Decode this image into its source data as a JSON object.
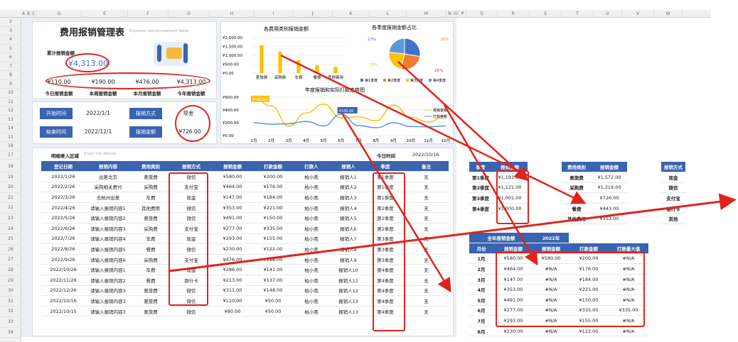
{
  "columns": [
    "A",
    "B",
    "C",
    "D",
    "E",
    "F",
    "G",
    "H",
    "I",
    "J",
    "K",
    "L",
    "M",
    "N",
    "O",
    "P",
    "Q",
    "R",
    "S",
    "T",
    "U",
    "V",
    "W"
  ],
  "rows": [
    "2",
    "3",
    "4",
    "5",
    "6",
    "7",
    "8",
    "9",
    "10",
    "11",
    "12",
    "13",
    "14",
    "15",
    "16",
    "17",
    "18",
    "19",
    "20",
    "21",
    "22",
    "23",
    "24",
    "25",
    "26",
    "27",
    "28",
    "29",
    "30",
    "31",
    "32",
    "33",
    "34"
  ],
  "dashboard": {
    "title": "费用报销管理表",
    "subtitle": "Expense reimbursement table",
    "total_label": "累计报销金额",
    "total_value": "¥4,313.00",
    "kpis": [
      {
        "value": "¥110.00",
        "label": "今日报销金额"
      },
      {
        "value": "¥190.00",
        "label": "本周报销金额"
      },
      {
        "value": "¥476.00",
        "label": "本月报销金额"
      },
      {
        "value": "¥4,313.00",
        "label": "今年报销金额"
      }
    ],
    "filters": {
      "start_label": "开始时间",
      "start_value": "2022/1/1",
      "method_label": "报销方式",
      "method_value": "现金",
      "end_label": "结束时间",
      "end_value": "2022/12/1",
      "amount_label": "报销金额",
      "amount_value": "¥726.00"
    }
  },
  "bar_chart": {
    "title": "各费用类别报销金额",
    "ticks": [
      "¥2,000.00",
      "¥1,500.00",
      "¥1,000.00",
      "¥500.00",
      "¥0.00"
    ]
  },
  "pie_chart": {
    "title": "各季度报销金额占比",
    "labels": [
      "23%",
      "28%",
      "26%",
      "23%"
    ],
    "legend": [
      "第1季度",
      "第2季度",
      "第3季度",
      "第4季度"
    ]
  },
  "line_chart": {
    "title": "年度报销和实际打款走势图",
    "ticks": [
      "¥600.00",
      "¥400.00",
      "¥200.00",
      "¥0.00"
    ],
    "callout1": "¥580.00",
    "callout2": "¥335.00",
    "legend": [
      "报销金额",
      "打款金额"
    ]
  },
  "chart_data": [
    {
      "type": "bar",
      "categories": [
        "差旅费",
        "采购费",
        "车费",
        "餐费",
        "其他费用"
      ],
      "values": [
        1572,
        1219,
        726,
        443,
        353
      ],
      "ylim": [
        0,
        2000
      ]
    },
    {
      "type": "pie",
      "categories": [
        "第1季度",
        "第2季度",
        "第3季度",
        "第4季度"
      ],
      "values": [
        1191,
        1121,
        1001,
        1000
      ],
      "colors": [
        "#4472c4",
        "#ed7d31",
        "#ffc000",
        "#5b9bd5"
      ]
    },
    {
      "type": "line",
      "categories": [
        "1月",
        "2月",
        "3月",
        "4月",
        "5月",
        "6月",
        "7月",
        "8月",
        "9月",
        "10月",
        "11月",
        "12月"
      ],
      "series": [
        {
          "name": "报销金额",
          "values": [
            580,
            464,
            147,
            353,
            491,
            277,
            293,
            230,
            476,
            286,
            213,
            311
          ],
          "color": "#ffc000"
        },
        {
          "name": "打款金额",
          "values": [
            200,
            176,
            184,
            221,
            150,
            335,
            155,
            122,
            198,
            141,
            137,
            148
          ],
          "color": "#5b9bd5"
        }
      ],
      "ylim": [
        0,
        600
      ]
    }
  ],
  "detail": {
    "section_label": "明细录入区域",
    "section_hint": "Enter the details",
    "today_label": "今日时间",
    "today_value": "2022/10/16",
    "headers": [
      "登记日期",
      "报销内容",
      "费用类别",
      "报销方式",
      "报销金额",
      "打款金额",
      "打款人",
      "报销人",
      "季度",
      "备注"
    ],
    "rows": [
      [
        "2022/1/26",
        "出差北京",
        "差旅费",
        "微信",
        "¥580.00",
        "¥200.00",
        "柏小莞",
        "报销人1",
        "第1季度",
        "无"
      ],
      [
        "2022/2/26",
        "采购相关费付",
        "采购费",
        "支付宝",
        "¥464.00",
        "¥176.00",
        "柏小莞",
        "报销人2",
        "第1季度",
        "无"
      ],
      [
        "2022/3/26",
        "去杭州出差",
        "车费",
        "现金",
        "¥147.00",
        "¥184.00",
        "柏小莞",
        "报销人3",
        "第1季度",
        "无"
      ],
      [
        "2022/4/26",
        "请输入报销内容1",
        "其他费用",
        "微信",
        "¥353.00",
        "¥221.00",
        "柏小莞",
        "报销人4",
        "第2季度",
        "无"
      ],
      [
        "2022/5/26",
        "请输入报销内容2",
        "差旅费",
        "微信",
        "¥491.00",
        "¥150.00",
        "柏小莞",
        "报销人5",
        "第2季度",
        "无"
      ],
      [
        "2022/6/26",
        "请输入报销内容3",
        "采购费",
        "支付宝",
        "¥277.00",
        "¥335.00",
        "柏小莞",
        "报销人6",
        "第2季度",
        "无"
      ],
      [
        "2022/7/26",
        "请输入报销内容4",
        "车费",
        "现金",
        "¥293.00",
        "¥155.00",
        "柏小莞",
        "报销人7",
        "第3季度",
        "无"
      ],
      [
        "2022/8/26",
        "请输入报销内容5",
        "餐费",
        "微信",
        "¥230.00",
        "¥122.00",
        "柏小莞",
        "报销人8",
        "第3季度",
        "无"
      ],
      [
        "2022/9/26",
        "请输入报销内容6",
        "采购费",
        "支付宝",
        "¥476.00",
        "¥198.00",
        "柏小莞",
        "报销人9",
        "第3季度",
        "无"
      ],
      [
        "2022/10/26",
        "请输入报销内容1",
        "车费",
        "现金",
        "¥286.00",
        "¥141.00",
        "柏小莞",
        "报销人10",
        "第4季度",
        "无"
      ],
      [
        "2022/11/26",
        "请输入报销内容2",
        "餐费",
        "银行卡",
        "¥213.00",
        "¥137.00",
        "柏小莞",
        "报销人11",
        "第4季度",
        "无"
      ],
      [
        "2022/12/26",
        "请输入报销内容3",
        "差旅费",
        "微信",
        "¥311.00",
        "¥148.00",
        "柏小莞",
        "报销人12",
        "第4季度",
        "无"
      ],
      [
        "2022/10/16",
        "请输入报销内容3",
        "差旅费",
        "微信",
        "¥110.00",
        "¥50.00",
        "柏小莞",
        "报销人13",
        "第4季度",
        "无"
      ],
      [
        "2022/10/15",
        "请输入报销内容3",
        "差旅费",
        "微信",
        "¥80.00",
        "¥50.00",
        "柏小莞",
        "报销人13",
        "第4季度",
        "无"
      ]
    ]
  },
  "quarter_table": {
    "headers": [
      "季度",
      "报销金额"
    ],
    "rows": [
      [
        "第1季度",
        "¥1,191.00"
      ],
      [
        "第2季度",
        "¥1,121.00"
      ],
      [
        "第3季度",
        "¥1,001.00"
      ],
      [
        "第4季度",
        "¥1,000.00"
      ]
    ]
  },
  "category_table": {
    "headers": [
      "费用类别",
      "报销金额"
    ],
    "rows": [
      [
        "差旅费",
        "¥1,572.00"
      ],
      [
        "采购费",
        "¥1,219.00"
      ],
      [
        "车费",
        "¥726.00"
      ],
      [
        "餐费",
        "¥443.00"
      ],
      [
        "其他费用",
        "¥353.00"
      ]
    ]
  },
  "method_table": {
    "header": "报销方式",
    "rows": [
      "现金",
      "微信",
      "支付宝",
      "银行卡",
      "其他"
    ]
  },
  "month_table": {
    "title": "全年报销金额",
    "year": "2022年",
    "headers": [
      "月份",
      "报销金额",
      "报销金额",
      "打款金额",
      "打款最大值"
    ],
    "rows": [
      [
        "1月",
        "¥580.00",
        "¥580.00",
        "¥200.00",
        "#N/A"
      ],
      [
        "2月",
        "¥464.00",
        "#N/A",
        "¥176.00",
        "#N/A"
      ],
      [
        "3月",
        "¥147.00",
        "#N/A",
        "¥184.00",
        "#N/A"
      ],
      [
        "4月",
        "¥353.00",
        "#N/A",
        "¥221.00",
        "#N/A"
      ],
      [
        "5月",
        "¥491.00",
        "#N/A",
        "¥150.00",
        "#N/A"
      ],
      [
        "6月",
        "¥277.00",
        "#N/A",
        "¥335.00",
        "¥335.00"
      ],
      [
        "7月",
        "¥293.00",
        "#N/A",
        "¥155.00",
        "#N/A"
      ],
      [
        "8月",
        "¥230.00",
        "#N/A",
        "¥122.00",
        "#N/A"
      ]
    ]
  }
}
